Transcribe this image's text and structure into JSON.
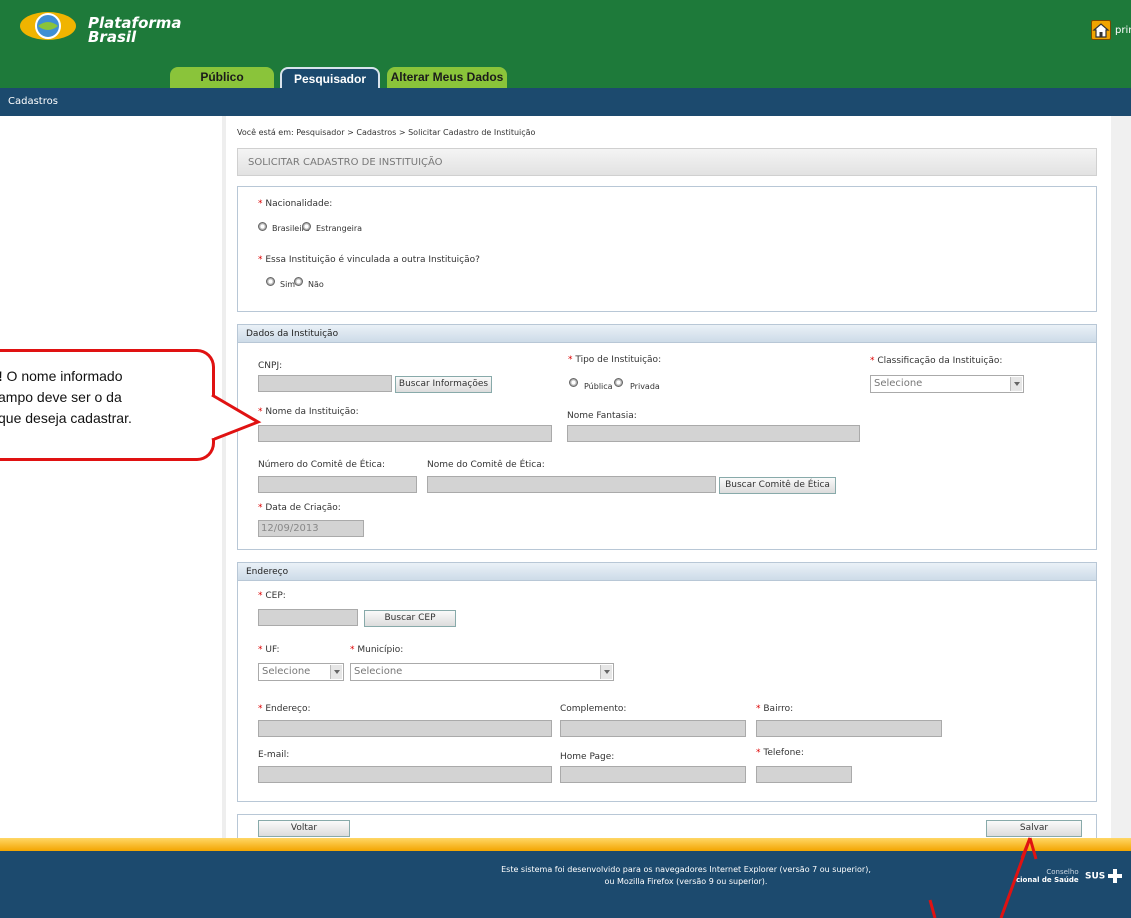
{
  "header": {
    "logo_line1": "Plataforma",
    "logo_line2": "Brasil",
    "home_label": "prin",
    "tabs": [
      {
        "label": "Público"
      },
      {
        "label": "Pesquisador"
      },
      {
        "label": "Alterar Meus Dados"
      }
    ],
    "nav": {
      "item": "Cadastros"
    }
  },
  "breadcrumb": "Você está em: Pesquisador > Cadastros > Solicitar Cadastro de Instituição",
  "page_title": "SOLICITAR CADASTRO DE INSTITUIÇÃO",
  "section1": {
    "nacionalidade_label": "Nacionalidade:",
    "opt_brasileira": "Brasileira",
    "opt_estrangeira": "Estrangeira",
    "vinculada_label": "Essa Instituição é vinculada a outra Instituição?",
    "opt_sim": "Sim",
    "opt_nao": "Não"
  },
  "instituicao": {
    "header": "Dados da Instituição",
    "cnpj_label": "CNPJ:",
    "buscar_info": "Buscar Informações",
    "tipo_label": "Tipo de Instituição:",
    "opt_publica": "Pública",
    "opt_privada": "Privada",
    "classificacao_label": "Classificação da Instituição:",
    "classificacao_value": "Selecione",
    "nome_label": "Nome da Instituição:",
    "fantasia_label": "Nome Fantasia:",
    "num_comite_label": "Número do Comitê de Ética:",
    "nome_comite_label": "Nome do Comitê de Ética:",
    "buscar_comite": "Buscar Comitê de Ética",
    "data_label": "Data de Criação:",
    "data_value": "12/09/2013"
  },
  "endereco": {
    "header": "Endereço",
    "cep_label": "CEP:",
    "buscar_cep": "Buscar CEP",
    "uf_label": "UF:",
    "uf_value": "Selecione",
    "municipio_label": "Município:",
    "municipio_value": "Selecione",
    "endereco_label": "Endereço:",
    "complemento_label": "Complemento:",
    "bairro_label": "Bairro:",
    "email_label": "E-mail:",
    "homepage_label": "Home Page:",
    "telefone_label": "Telefone:"
  },
  "actions": {
    "voltar": "Voltar",
    "salvar": "Salvar"
  },
  "footer": {
    "line1": "Este sistema foi desenvolvido para os navegadores Internet Explorer (versão 7 ou superior),",
    "line2": "ou Mozilla Firefox (versão 9 ou superior).",
    "cns_line1": "Conselho",
    "cns_line2": "cional de Saúde",
    "sus": "SUS"
  },
  "callout": {
    "bold": "!",
    "line1": " O nome informado",
    "line2": "ampo deve ser o da",
    "line3": " que deseja cadastrar."
  },
  "colors": {
    "header_green": "#1e7a3a",
    "nav_blue": "#1c4a6e",
    "tab_green": "#8ac43a",
    "callout_red": "#e01212"
  }
}
